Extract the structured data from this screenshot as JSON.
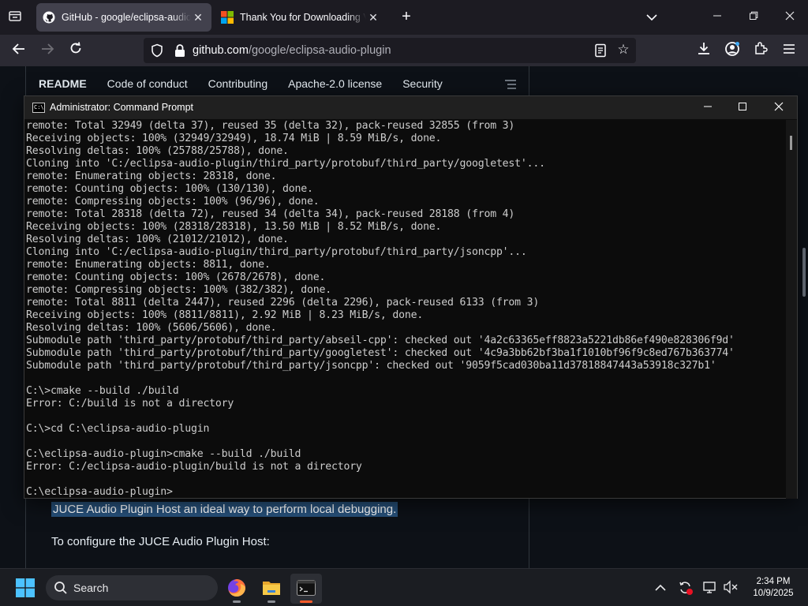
{
  "browser": {
    "tabs": [
      {
        "title": "GitHub - google/eclipsa-audio-plugin",
        "active": true
      },
      {
        "title": "Thank You for Downloading Visual Studio",
        "active": false
      }
    ],
    "url_host": "github.com",
    "url_path": "/google/eclipsa-audio-plugin"
  },
  "readme_nav": {
    "items": [
      "README",
      "Code of conduct",
      "Contributing",
      "Apache-2.0 license",
      "Security"
    ]
  },
  "page": {
    "highlighted_text": "JUCE Audio Plugin Host an ideal way to perform local debugging.",
    "paragraph": "To configure the JUCE Audio Plugin Host:"
  },
  "cmd": {
    "title": "Administrator: Command Prompt",
    "lines": [
      "remote: Total 32949 (delta 37), reused 35 (delta 32), pack-reused 32855 (from 3)",
      "Receiving objects: 100% (32949/32949), 18.74 MiB | 8.59 MiB/s, done.",
      "Resolving deltas: 100% (25788/25788), done.",
      "Cloning into 'C:/eclipsa-audio-plugin/third_party/protobuf/third_party/googletest'...",
      "remote: Enumerating objects: 28318, done.",
      "remote: Counting objects: 100% (130/130), done.",
      "remote: Compressing objects: 100% (96/96), done.",
      "remote: Total 28318 (delta 72), reused 34 (delta 34), pack-reused 28188 (from 4)",
      "Receiving objects: 100% (28318/28318), 13.50 MiB | 8.52 MiB/s, done.",
      "Resolving deltas: 100% (21012/21012), done.",
      "Cloning into 'C:/eclipsa-audio-plugin/third_party/protobuf/third_party/jsoncpp'...",
      "remote: Enumerating objects: 8811, done.",
      "remote: Counting objects: 100% (2678/2678), done.",
      "remote: Compressing objects: 100% (382/382), done.",
      "remote: Total 8811 (delta 2447), reused 2296 (delta 2296), pack-reused 6133 (from 3)",
      "Receiving objects: 100% (8811/8811), 2.92 MiB | 8.23 MiB/s, done.",
      "Resolving deltas: 100% (5606/5606), done.",
      "Submodule path 'third_party/protobuf/third_party/abseil-cpp': checked out '4a2c63365eff8823a5221db86ef490e828306f9d'",
      "Submodule path 'third_party/protobuf/third_party/googletest': checked out '4c9a3bb62bf3ba1f1010bf96f9c8ed767b363774'",
      "Submodule path 'third_party/protobuf/third_party/jsoncpp': checked out '9059f5cad030ba11d37818847443a53918c327b1'",
      "",
      "C:\\>cmake --build ./build",
      "Error: C:/build is not a directory",
      "",
      "C:\\>cd C:\\eclipsa-audio-plugin",
      "",
      "C:\\eclipsa-audio-plugin>cmake --build ./build",
      "Error: C:/eclipsa-audio-plugin/build is not a directory",
      "",
      "C:\\eclipsa-audio-plugin>"
    ]
  },
  "taskbar": {
    "search_label": "Search",
    "time": "2:34 PM",
    "date": "10/9/2025"
  },
  "colors": {
    "accent_firefox": "#ff5c2b",
    "github_bg": "#0d1117",
    "selection": "#264f78",
    "cmd_bg": "#0c0c0c"
  }
}
